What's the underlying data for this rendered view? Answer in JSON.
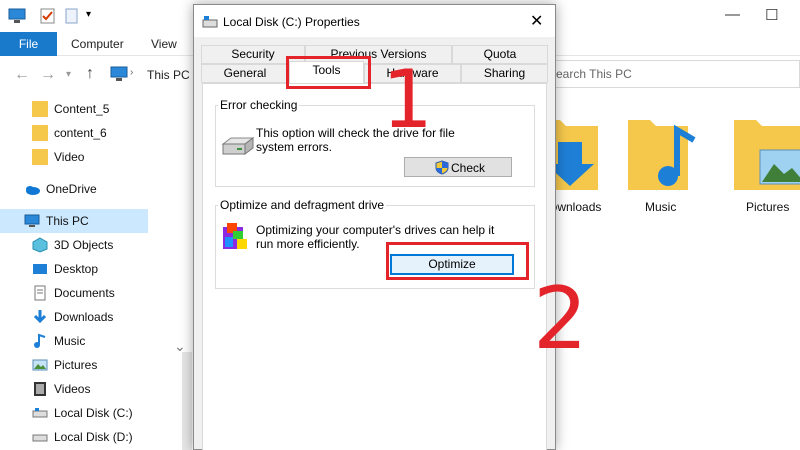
{
  "explorer": {
    "ribbon_tabs": {
      "file": "File",
      "computer": "Computer",
      "view": "View"
    },
    "breadcrumb": "This PC",
    "search_placeholder": "Search This PC",
    "window_controls": {
      "minimize": "—",
      "maximize": "☐"
    },
    "sidebar": [
      {
        "label": "Content_5",
        "icon": "folder-icon"
      },
      {
        "label": "content_6",
        "icon": "folder-icon"
      },
      {
        "label": "Video",
        "icon": "folder-icon"
      },
      {
        "label": "OneDrive",
        "icon": "onedrive-icon"
      },
      {
        "label": "This PC",
        "icon": "computer-icon",
        "selected": true
      },
      {
        "label": "3D Objects",
        "icon": "cube-icon"
      },
      {
        "label": "Desktop",
        "icon": "desktop-icon"
      },
      {
        "label": "Documents",
        "icon": "documents-icon"
      },
      {
        "label": "Downloads",
        "icon": "downloads-icon"
      },
      {
        "label": "Music",
        "icon": "music-icon"
      },
      {
        "label": "Pictures",
        "icon": "pictures-icon"
      },
      {
        "label": "Videos",
        "icon": "videos-icon"
      },
      {
        "label": "Local Disk (C:)",
        "icon": "drive-icon"
      },
      {
        "label": "Local Disk (D:)",
        "icon": "drive-icon"
      }
    ],
    "folders": [
      {
        "label": "Downloads",
        "icon": "downloads-folder-icon"
      },
      {
        "label": "Music",
        "icon": "music-folder-icon"
      },
      {
        "label": "Pictures",
        "icon": "pictures-folder-icon"
      }
    ]
  },
  "dialog": {
    "title": "Local Disk (C:) Properties",
    "close_glyph": "✕",
    "tabs_row1": [
      "Security",
      "Previous Versions",
      "Quota"
    ],
    "tabs_row2": [
      "General",
      "Tools",
      "Hardware",
      "Sharing"
    ],
    "active_tab": "Tools",
    "error_checking": {
      "title": "Error checking",
      "text": "This option will check the drive for file system errors.",
      "button": "Check"
    },
    "optimize": {
      "title": "Optimize and defragment drive",
      "text": "Optimizing your computer's drives can help it run more efficiently.",
      "button": "Optimize"
    }
  },
  "annotations": {
    "step1": "1",
    "step2": "2"
  },
  "colors": {
    "accent": "#1979ca",
    "annotation_red": "#e3242b",
    "folder_yellow": "#f5c84c"
  }
}
